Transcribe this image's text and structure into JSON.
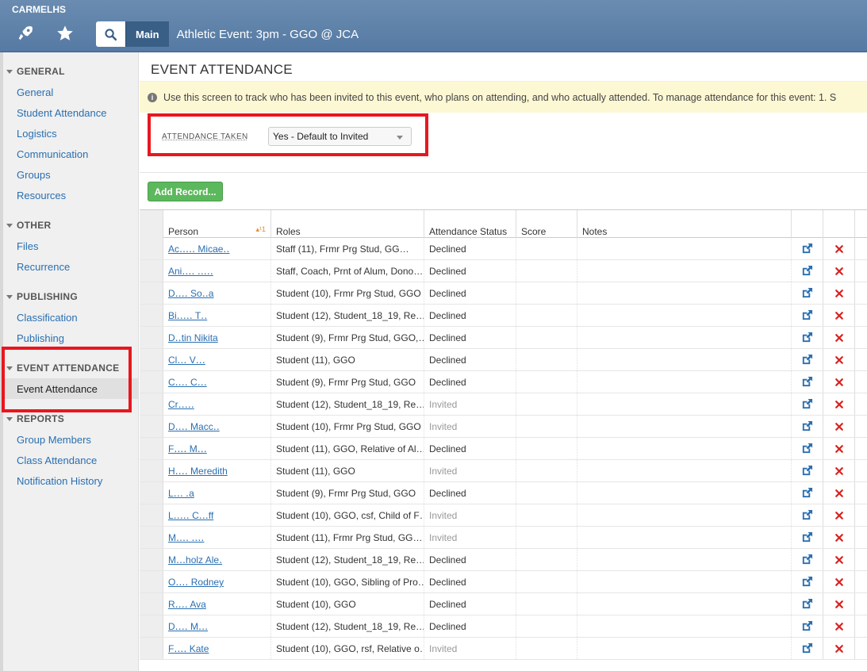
{
  "app": {
    "org": "CARMELHS"
  },
  "breadcrumb": {
    "main": "Main",
    "title": "Athletic Event: 3pm - GGO @ JCA"
  },
  "sidebar": {
    "sections": [
      {
        "title": "GENERAL",
        "items": [
          "General",
          "Student Attendance",
          "Logistics",
          "Communication",
          "Groups",
          "Resources"
        ]
      },
      {
        "title": "OTHER",
        "items": [
          "Files",
          "Recurrence"
        ]
      },
      {
        "title": "PUBLISHING",
        "items": [
          "Classification",
          "Publishing"
        ]
      },
      {
        "title": "EVENT ATTENDANCE",
        "items": [
          "Event Attendance"
        ]
      },
      {
        "title": "REPORTS",
        "items": [
          "Group Members",
          "Class Attendance",
          "Notification History"
        ]
      }
    ],
    "active_item": "Event Attendance"
  },
  "page": {
    "title": "EVENT ATTENDANCE",
    "info": "Use this screen to track who has been invited to this event, who plans on attending, and who actually attended. To manage attendance for this event: 1. S",
    "attendance_label": "ATTENDANCE TAKEN",
    "attendance_value": "Yes - Default to Invited",
    "add_button": "Add Record..."
  },
  "table": {
    "headers": {
      "person": "Person",
      "sort": "▴¹1",
      "roles": "Roles",
      "status": "Attendance Status",
      "score": "Score",
      "notes": "Notes"
    },
    "rows": [
      {
        "person": "Ac․․․․․ Micae․․",
        "roles": "Staff (11), Frmr Prg Stud, GG…",
        "status": "Declined"
      },
      {
        "person": "Ani․․․․ ․․․․․",
        "roles": "Staff, Coach, Prnt of Alum, Dono…",
        "status": "Declined"
      },
      {
        "person": "D․․․․ So․․a",
        "roles": "Student (10), Frmr Prg Stud, GGO",
        "status": "Declined"
      },
      {
        "person": "Bi․․․․․ T․․",
        "roles": "Student (12), Student_18_19, Re…",
        "status": "Declined"
      },
      {
        "person": "D․․tin Nikita",
        "roles": "Student (9), Frmr Prg Stud, GGO,…",
        "status": "Declined"
      },
      {
        "person": "Cl․․․ V․․․",
        "roles": "Student (11), GGO",
        "status": "Declined"
      },
      {
        "person": "C․․․․ C․․․",
        "roles": "Student (9), Frmr Prg Stud, GGO",
        "status": "Declined"
      },
      {
        "person": "Cr․․․․․",
        "roles": "Student (12), Student_18_19, Re…",
        "status": "Invited"
      },
      {
        "person": "D․․․․ Macc․․",
        "roles": "Student (10), Frmr Prg Stud, GGO",
        "status": "Invited"
      },
      {
        "person": "F․․․․ M․․․",
        "roles": "Student (11), GGO, Relative of Al…",
        "status": "Declined"
      },
      {
        "person": "H․․․․ Meredith",
        "roles": "Student (11), GGO",
        "status": "Invited"
      },
      {
        "person": "L․․․ ․a",
        "roles": "Student (9), Frmr Prg Stud, GGO",
        "status": "Declined"
      },
      {
        "person": "L․․․․․ C․․․ff",
        "roles": "Student (10), GGO, csf, Child of F…",
        "status": "Invited"
      },
      {
        "person": "M․․․․ ․․․․",
        "roles": "Student (11), Frmr Prg Stud, GG…",
        "status": "Invited"
      },
      {
        "person": "M․․․holz Ale․",
        "roles": "Student (12), Student_18_19, Re…",
        "status": "Declined"
      },
      {
        "person": "O․․․․ Rodney",
        "roles": "Student (10), GGO, Sibling of Pro…",
        "status": "Declined"
      },
      {
        "person": "R․․․․ Ava",
        "roles": "Student (10), GGO",
        "status": "Declined"
      },
      {
        "person": "D․․․․ M․․․",
        "roles": "Student (12), Student_18_19, Re…",
        "status": "Declined"
      },
      {
        "person": "F․․․․ Kate",
        "roles": "Student (10), GGO, rsf, Relative o…",
        "status": "Invited"
      }
    ]
  },
  "colors": {
    "accent": "#2a6fb0",
    "add_button": "#5cb85c",
    "highlight_box": "#e8171f",
    "banner": "#fcf8d4",
    "delete": "#d9231f"
  },
  "icons": {
    "top": [
      "rocket-icon",
      "star-icon"
    ],
    "search": "search-icon",
    "row_actions": [
      "open-external-icon",
      "delete-icon"
    ]
  }
}
